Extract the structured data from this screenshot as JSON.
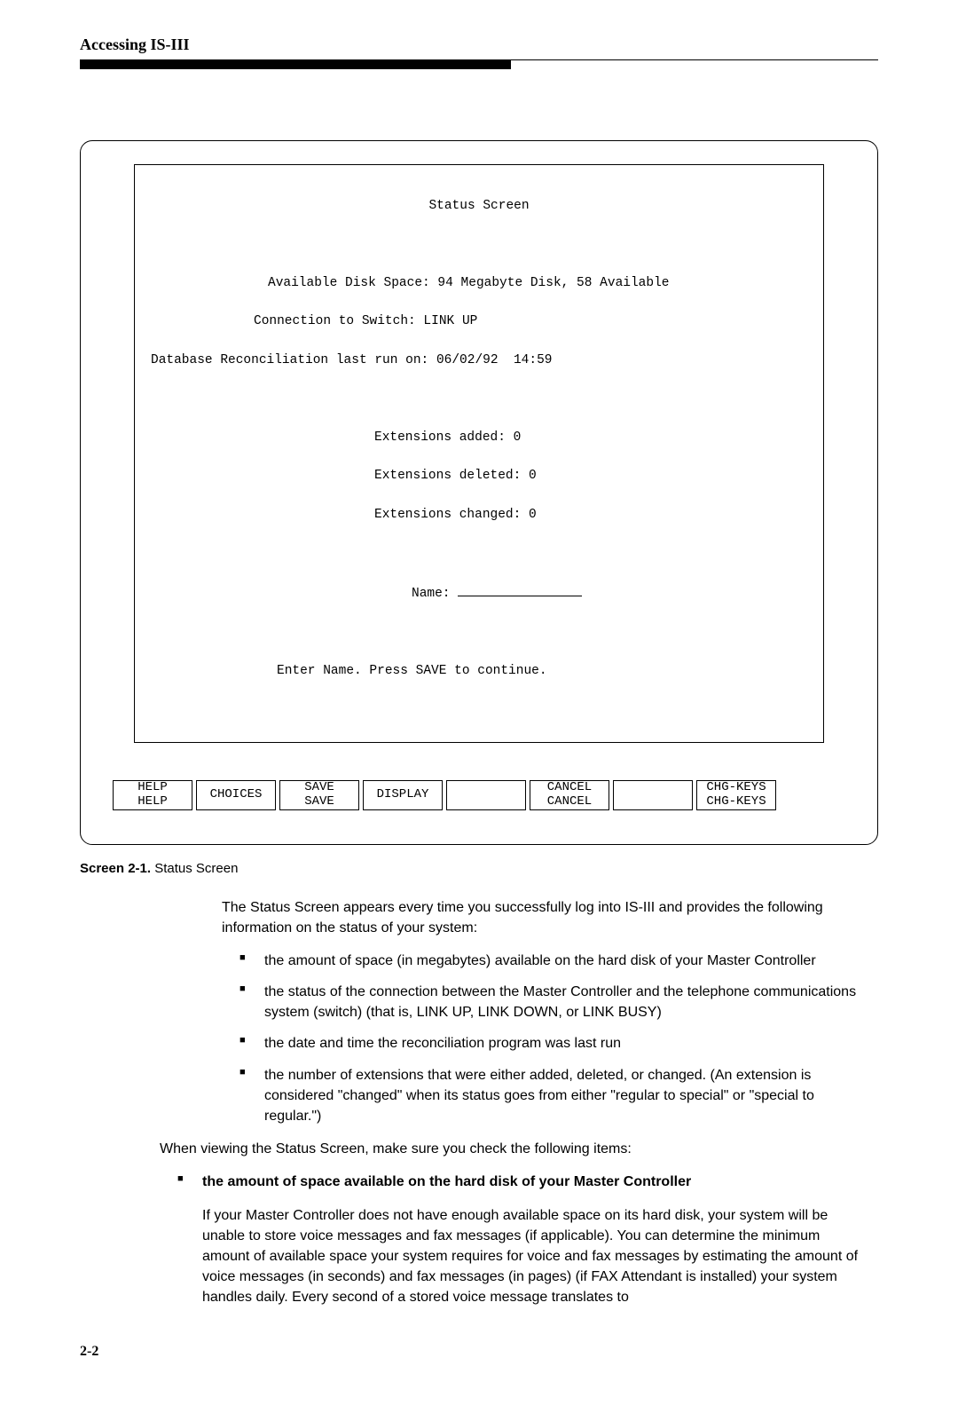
{
  "header": {
    "title": "Accessing IS-III"
  },
  "terminal": {
    "title": "Status Screen",
    "line_avail": "Available Disk Space: 94 Megabyte Disk, 58 Available",
    "line_conn": "Connection to Switch: LINK UP",
    "line_recon": "Database Reconciliation last run on: 06/02/92  14:59",
    "line_ext_added": "Extensions added: 0",
    "line_ext_deleted": "Extensions deleted: 0",
    "line_ext_changed": "Extensions changed: 0",
    "line_name_label": "Name:",
    "line_prompt": "Enter Name. Press SAVE to continue."
  },
  "fkeys": {
    "f1_top": "HELP",
    "f1_bot": "HELP",
    "f2_top": "",
    "f2_bot": "CHOICES",
    "f3_top": "SAVE",
    "f3_bot": "SAVE",
    "f4_top": "DISPLAY",
    "f4_bot": "",
    "f5_top": "",
    "f5_bot": "",
    "f6_top": "CANCEL",
    "f6_bot": "CANCEL",
    "f7_top": "",
    "f7_bot": "",
    "f8_top": "CHG-KEYS",
    "f8_bot": "CHG-KEYS"
  },
  "caption": {
    "label": "Screen 2-1.",
    "text": " Status Screen"
  },
  "body": {
    "intro": "The Status Screen appears every time you successfully log into IS-III and provides the following information on the status of your system:",
    "bullets": [
      "the amount of space (in megabytes) available on the hard disk of your Master Controller",
      "the status of the connection between the Master Controller and the telephone communications system (switch) (that is, LINK UP, LINK DOWN, or LINK BUSY)",
      "the date and time the reconciliation program was last run",
      "the number of extensions that were either added, deleted, or changed. (An extension is considered \"changed\" when its status goes from either \"regular to special\" or \"special to regular.\")"
    ],
    "check_intro": "When viewing the Status Screen, make sure you check the following items:",
    "check_bullet": "the amount of space available on the hard disk of your Master Controller",
    "check_para": "If your Master Controller does not have enough available space on its hard disk, your system will be unable to store voice messages and fax messages (if applicable). You can determine the minimum amount of available space your system requires for voice and fax messages by estimating the amount of voice messages (in seconds) and fax messages (in pages) (if FAX Attendant is installed) your system handles daily. Every second of a stored voice message translates to"
  },
  "page_number": "2-2"
}
